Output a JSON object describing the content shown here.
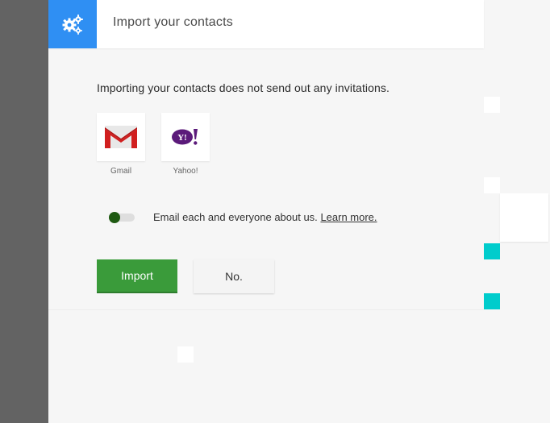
{
  "header": {
    "title": "Import your contacts",
    "icon": "gears-icon",
    "accent": "#2f8ff3"
  },
  "intro": "Importing your contacts does not send out any invitations.",
  "providers": [
    {
      "label": "Gmail",
      "icon": "gmail-icon"
    },
    {
      "label": "Yahoo!",
      "icon": "yahoo-icon"
    }
  ],
  "email_option": {
    "text": "Email each and everyone about us.",
    "link": "Learn more.",
    "enabled": true
  },
  "actions": {
    "import_label": "Import",
    "no_label": "No.",
    "import_color": "#3a9b3a"
  },
  "colors": {
    "rail": "#636363",
    "teal": "#00cccc"
  }
}
